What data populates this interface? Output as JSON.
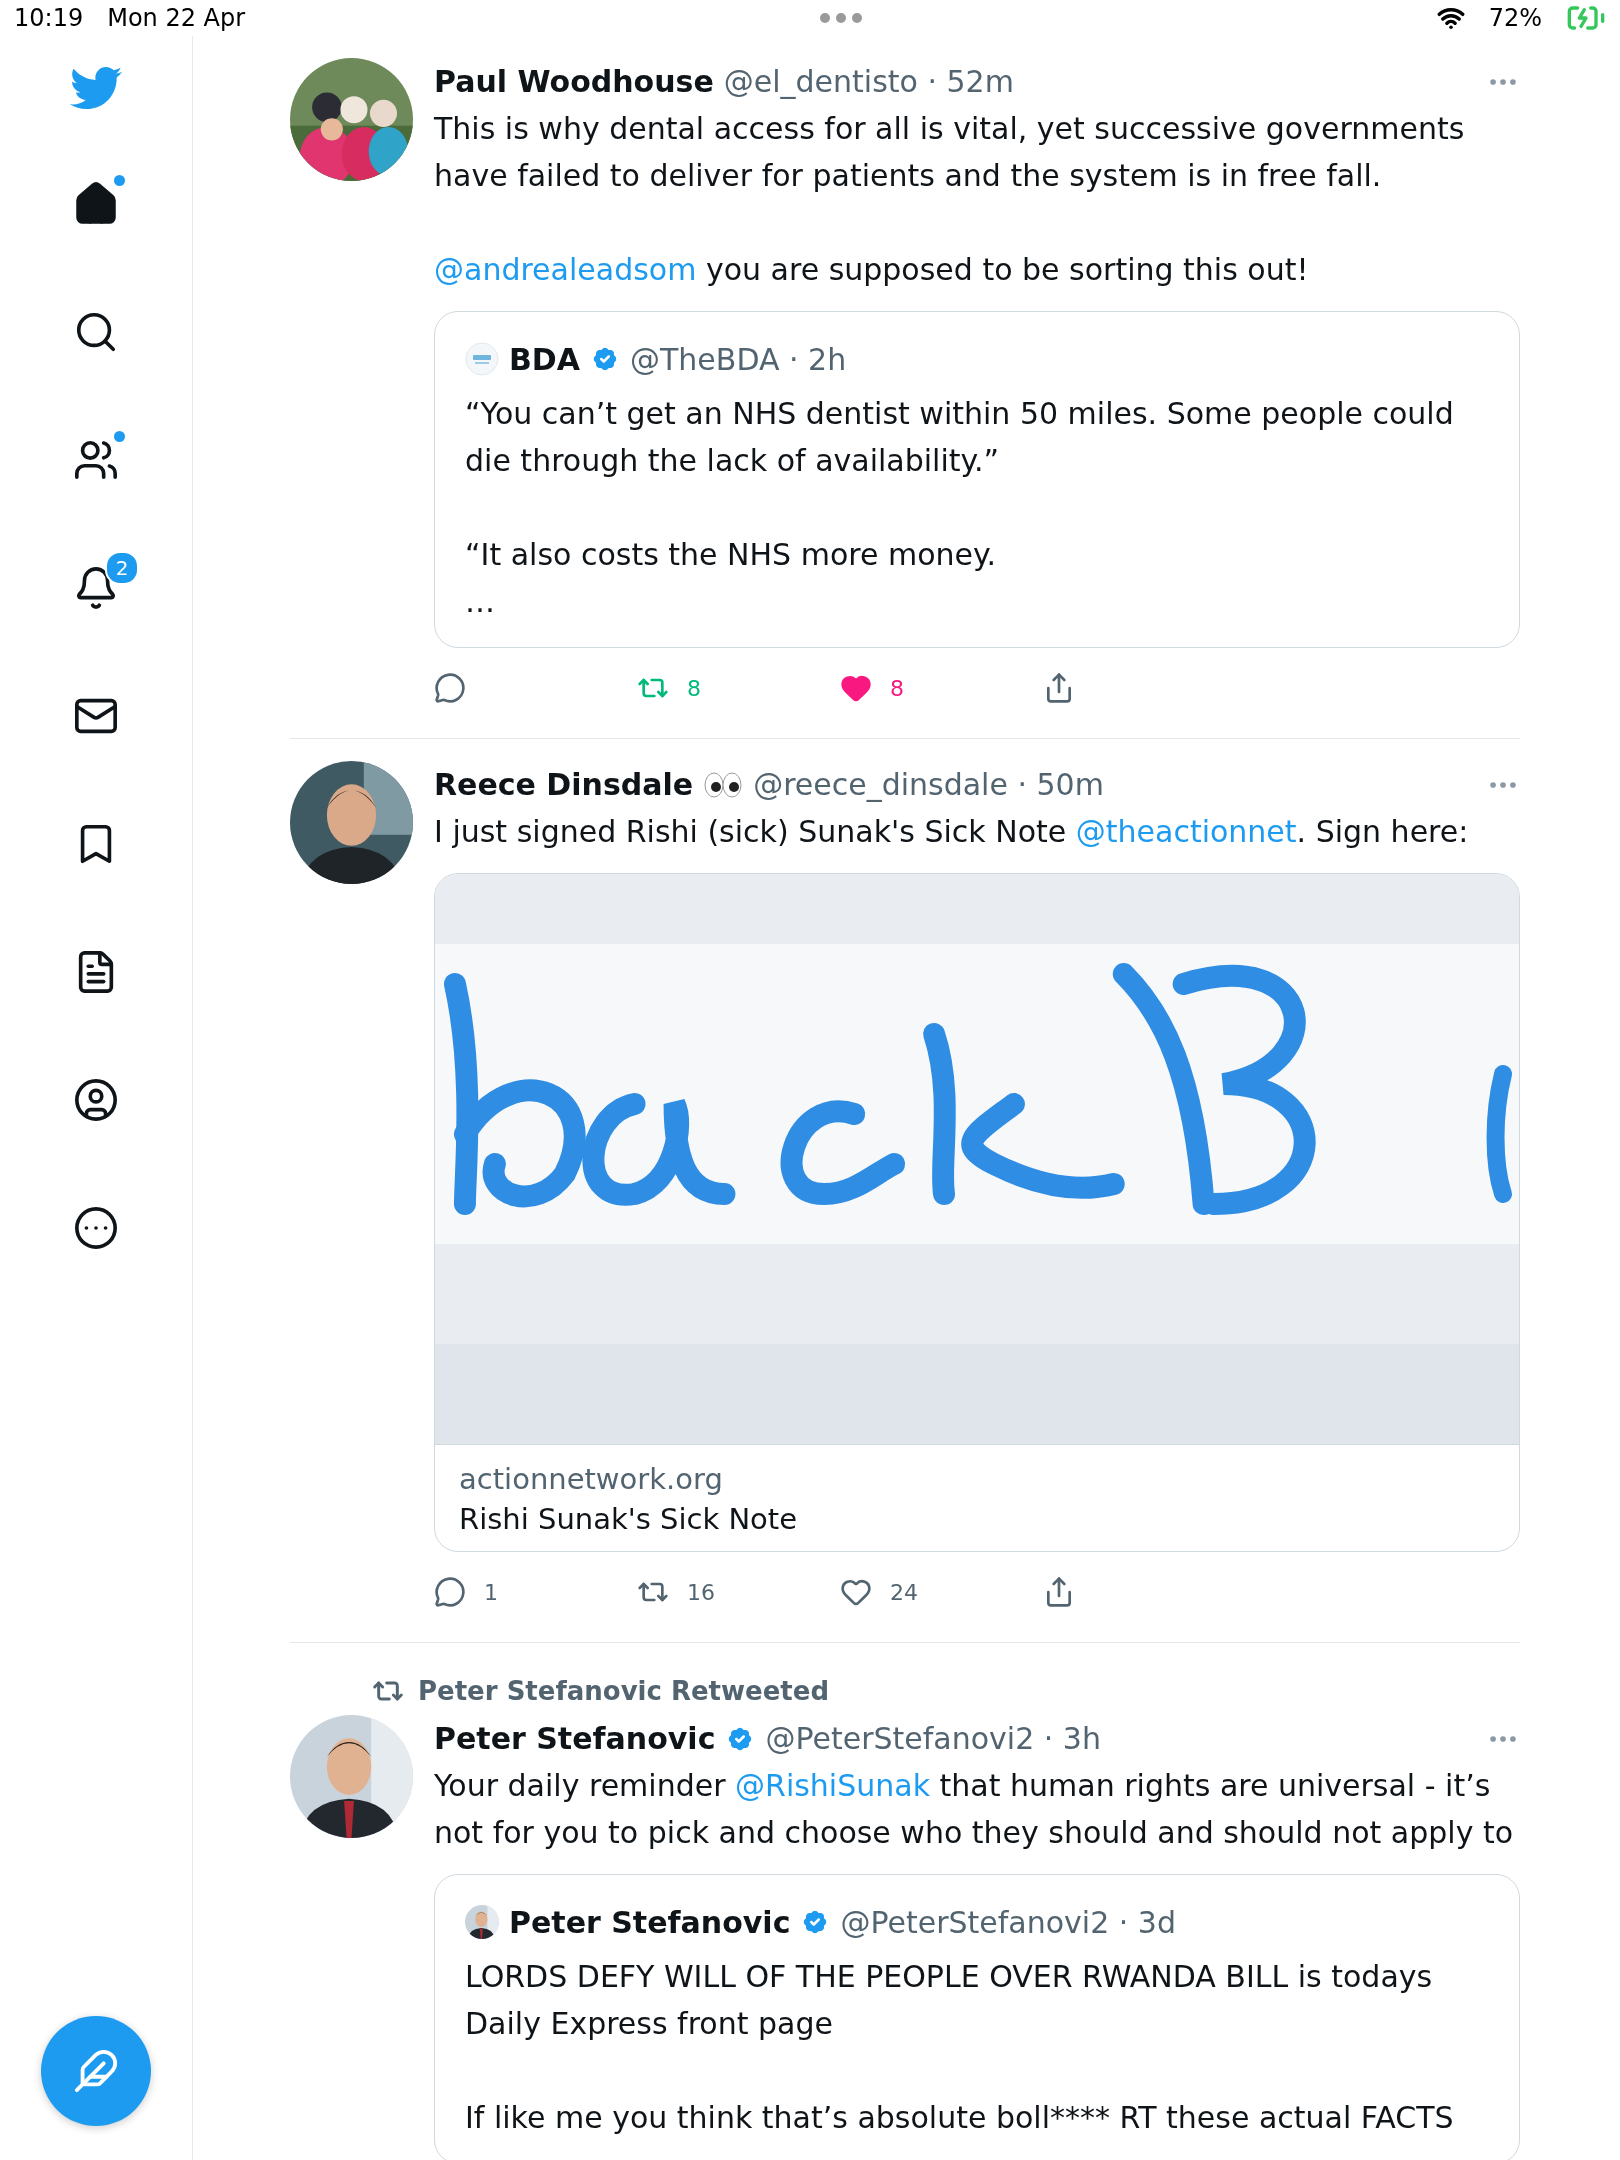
{
  "status_bar": {
    "time": "10:19",
    "date": "Mon 22 Apr",
    "battery": "72%"
  },
  "sidebar": {
    "items": [
      {
        "kind": "home",
        "selected": true,
        "dot": true
      },
      {
        "kind": "search",
        "selected": false,
        "dot": false
      },
      {
        "kind": "communities",
        "selected": false,
        "dot": true
      },
      {
        "kind": "notifications",
        "selected": false,
        "dot": false,
        "badge": "2"
      },
      {
        "kind": "messages",
        "selected": false,
        "dot": false
      },
      {
        "kind": "bookmarks",
        "selected": false,
        "dot": false
      },
      {
        "kind": "lists",
        "selected": false,
        "dot": false
      },
      {
        "kind": "profile",
        "selected": false,
        "dot": false
      },
      {
        "kind": "more",
        "selected": false,
        "dot": false
      }
    ]
  },
  "tweets": [
    {
      "author": "Paul Woodhouse",
      "verified": false,
      "meta": "@el_dentisto · 52m",
      "paragraphs": [
        [
          {
            "kind": "text",
            "text": "This is why dental access for all is vital, yet successive governments have failed to deliver for patients and the system is in free fall."
          }
        ],
        [
          {
            "kind": "mention",
            "text": "@andrealeadsom"
          },
          {
            "kind": "text",
            "text": " you are supposed to be sorting this out!"
          }
        ]
      ],
      "quote": {
        "kind": "logo_avatar",
        "author": "BDA",
        "verified": true,
        "meta": "@TheBDA · 2h",
        "paragraphs": [
          "“You can’t get an NHS dentist within 50 miles. Some people could die through the lack of availability.”",
          "“It also costs the NHS more money.\n…"
        ]
      },
      "actions": [
        {
          "kind": "reply",
          "active": false
        },
        {
          "kind": "retweet",
          "count": "8",
          "active": true
        },
        {
          "kind": "like",
          "count": "8",
          "active": true
        },
        {
          "kind": "share",
          "active": false
        }
      ]
    },
    {
      "author": "Reece Dinsdale",
      "name_emoji": {
        "kind": "eyes"
      },
      "verified": false,
      "meta": "@reece_dinsdale · 50m",
      "paragraphs": [
        [
          {
            "kind": "text",
            "text": "I just signed Rishi (sick) Sunak's Sick Note "
          },
          {
            "kind": "mention",
            "text": "@theactionnet"
          },
          {
            "kind": "text",
            "text": ". Sign here:"
          }
        ]
      ],
      "link_card": {
        "domain": "actionnetwork.org",
        "title": "Rishi Sunak's Sick Note"
      },
      "actions": [
        {
          "kind": "reply",
          "count": "1",
          "active": false
        },
        {
          "kind": "retweet",
          "count": "16",
          "active": false
        },
        {
          "kind": "like",
          "count": "24",
          "active": false
        },
        {
          "kind": "share",
          "active": false
        }
      ]
    },
    {
      "retweeted_by": "Peter Stefanovic Retweeted",
      "author": "Peter Stefanovic",
      "verified": true,
      "meta": "@PeterStefanovi2 · 3h",
      "paragraphs": [
        [
          {
            "kind": "text",
            "text": "Your daily reminder "
          },
          {
            "kind": "mention",
            "text": "@RishiSunak"
          },
          {
            "kind": "text",
            "text": " that human rights are universal - it’s not for you to pick and choose who they should and should not apply to"
          }
        ]
      ],
      "quote": {
        "kind": "photo_avatar",
        "author": "Peter Stefanovic",
        "verified": true,
        "meta": "@PeterStefanovi2 · 3d",
        "paragraphs": [
          "LORDS DEFY WILL OF THE PEOPLE OVER RWANDA BILL is todays Daily Express front page",
          "If like me you think that’s absolute boll**** RT these actual FACTS"
        ]
      }
    }
  ]
}
